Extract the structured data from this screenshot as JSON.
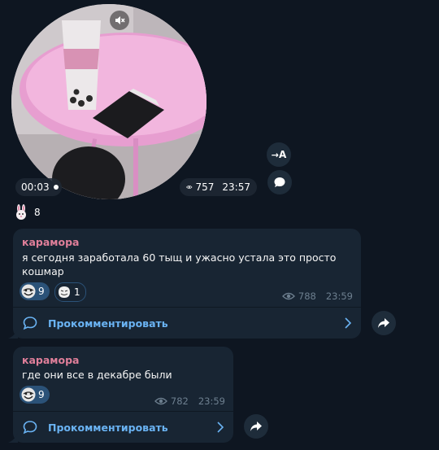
{
  "video_note": {
    "duration": "00:03",
    "views": "757",
    "time": "23:57",
    "translate_label": "A",
    "reactions": [
      {
        "icon": "bunny-emoji",
        "count": "8"
      }
    ]
  },
  "posts": [
    {
      "author": "карамора",
      "text_lines": [
        "я сегодня заработала 60 тыщ и ужасно устала это просто",
        "кошмар"
      ],
      "reactions": [
        {
          "icon": "troll-face-emoji",
          "count": "9"
        },
        {
          "icon": "trollface-meme-emoji",
          "count": "1"
        }
      ],
      "views": "788",
      "time": "23:59",
      "comment_label": "Прокомментировать"
    },
    {
      "author": "карамора",
      "text_lines": [
        "где они все в декабре были"
      ],
      "reactions": [
        {
          "icon": "troll-face-emoji",
          "count": "9"
        }
      ],
      "views": "782",
      "time": "23:59",
      "comment_label": "Прокомментировать"
    }
  ],
  "colors": {
    "background": "#0e1621",
    "bubble": "#182533",
    "author": "#e07f9a",
    "link": "#6ab3f3",
    "reaction_chip": "#2b5278",
    "muted_text": "#6d7f8f"
  }
}
